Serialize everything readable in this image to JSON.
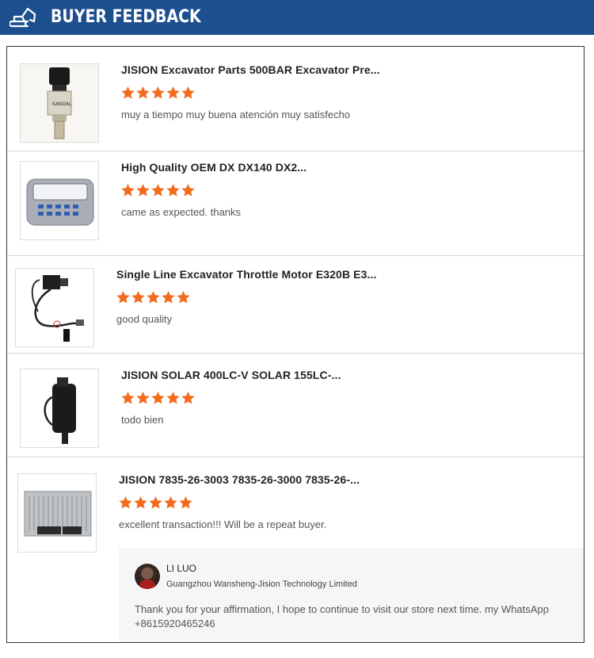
{
  "header": {
    "title": "BUYER FEEDBACK",
    "icon": "excavator-icon",
    "background": "#1d4f8f"
  },
  "rating_color": "#f26b1d",
  "reviews": [
    {
      "product_title": "JISION Excavator Parts 500BAR Excavator Pre...",
      "rating": 5,
      "comment": "muy a tiempo muy buena atención muy satisfecho",
      "thumbnail": "pressure-sensor-image"
    },
    {
      "product_title": "High Quality OEM                         DX DX140 DX2...",
      "rating": 5,
      "comment": "came as expected. thanks",
      "thumbnail": "monitor-display-image"
    },
    {
      "product_title": "Single Line Excavator Throttle Motor E320B E3...",
      "rating": 5,
      "comment": "good quality",
      "thumbnail": "throttle-motor-image"
    },
    {
      "product_title": "JISION               SOLAR 400LC-V SOLAR 155LC-...",
      "rating": 5,
      "comment": "todo bien",
      "thumbnail": "throttle-actuator-image"
    },
    {
      "product_title": "JISION 7835-26-3003 7835-26-3000 7835-26-...",
      "rating": 5,
      "comment": "excellent transaction!!!  Will be a repeat buyer.",
      "thumbnail": "controller-unit-image"
    }
  ],
  "reply": {
    "name": "LI LUO",
    "company": "Guangzhou Wansheng-Jision Technology Limited",
    "text": "Thank you for your affirmation, I hope to continue to visit our store next time. my WhatsApp +8615920465246"
  }
}
